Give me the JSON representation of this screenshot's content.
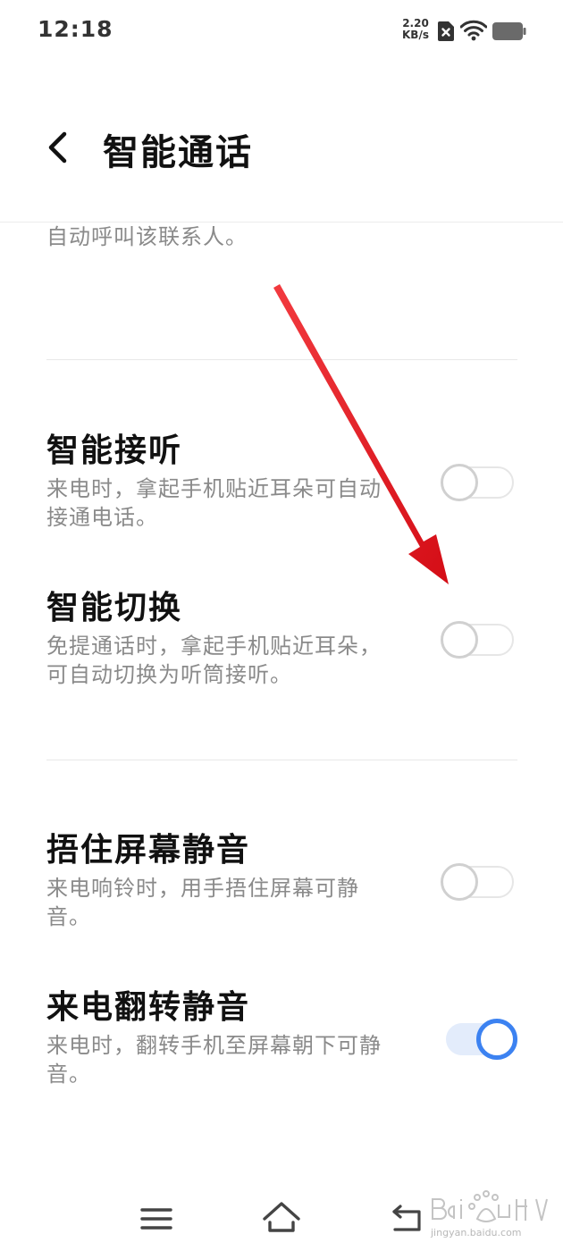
{
  "status_bar": {
    "time": "12:18",
    "net_speed_value": "2.20",
    "net_speed_unit": "KB/s"
  },
  "header": {
    "title": "智能通话"
  },
  "items": [
    {
      "title": "",
      "desc": "在联系人详情、信息会话、通话记录详情界面拿起手机贴近耳朵，可自动呼叫该联系人。",
      "enabled": false
    },
    {
      "title": "智能接听",
      "desc": "来电时，拿起手机贴近耳朵可自动接通电话。",
      "enabled": false
    },
    {
      "title": "智能切换",
      "desc": "免提通话时，拿起手机贴近耳朵，可自动切换为听筒接听。",
      "enabled": false
    },
    {
      "title": "捂住屏幕静音",
      "desc": "来电响铃时，用手捂住屏幕可静音。",
      "enabled": false
    },
    {
      "title": "来电翻转静音",
      "desc": "来电时，翻转手机至屏幕朝下可静音。",
      "enabled": true
    }
  ],
  "colors": {
    "accent": "#3c82f1",
    "annotation_arrow": "#e8131b"
  },
  "icons": {
    "back": "chevron-left-icon",
    "nav_menu": "menu-icon",
    "nav_home": "home-icon",
    "nav_back": "return-icon"
  },
  "watermark": {
    "text": "jingyan.baidu.com"
  }
}
